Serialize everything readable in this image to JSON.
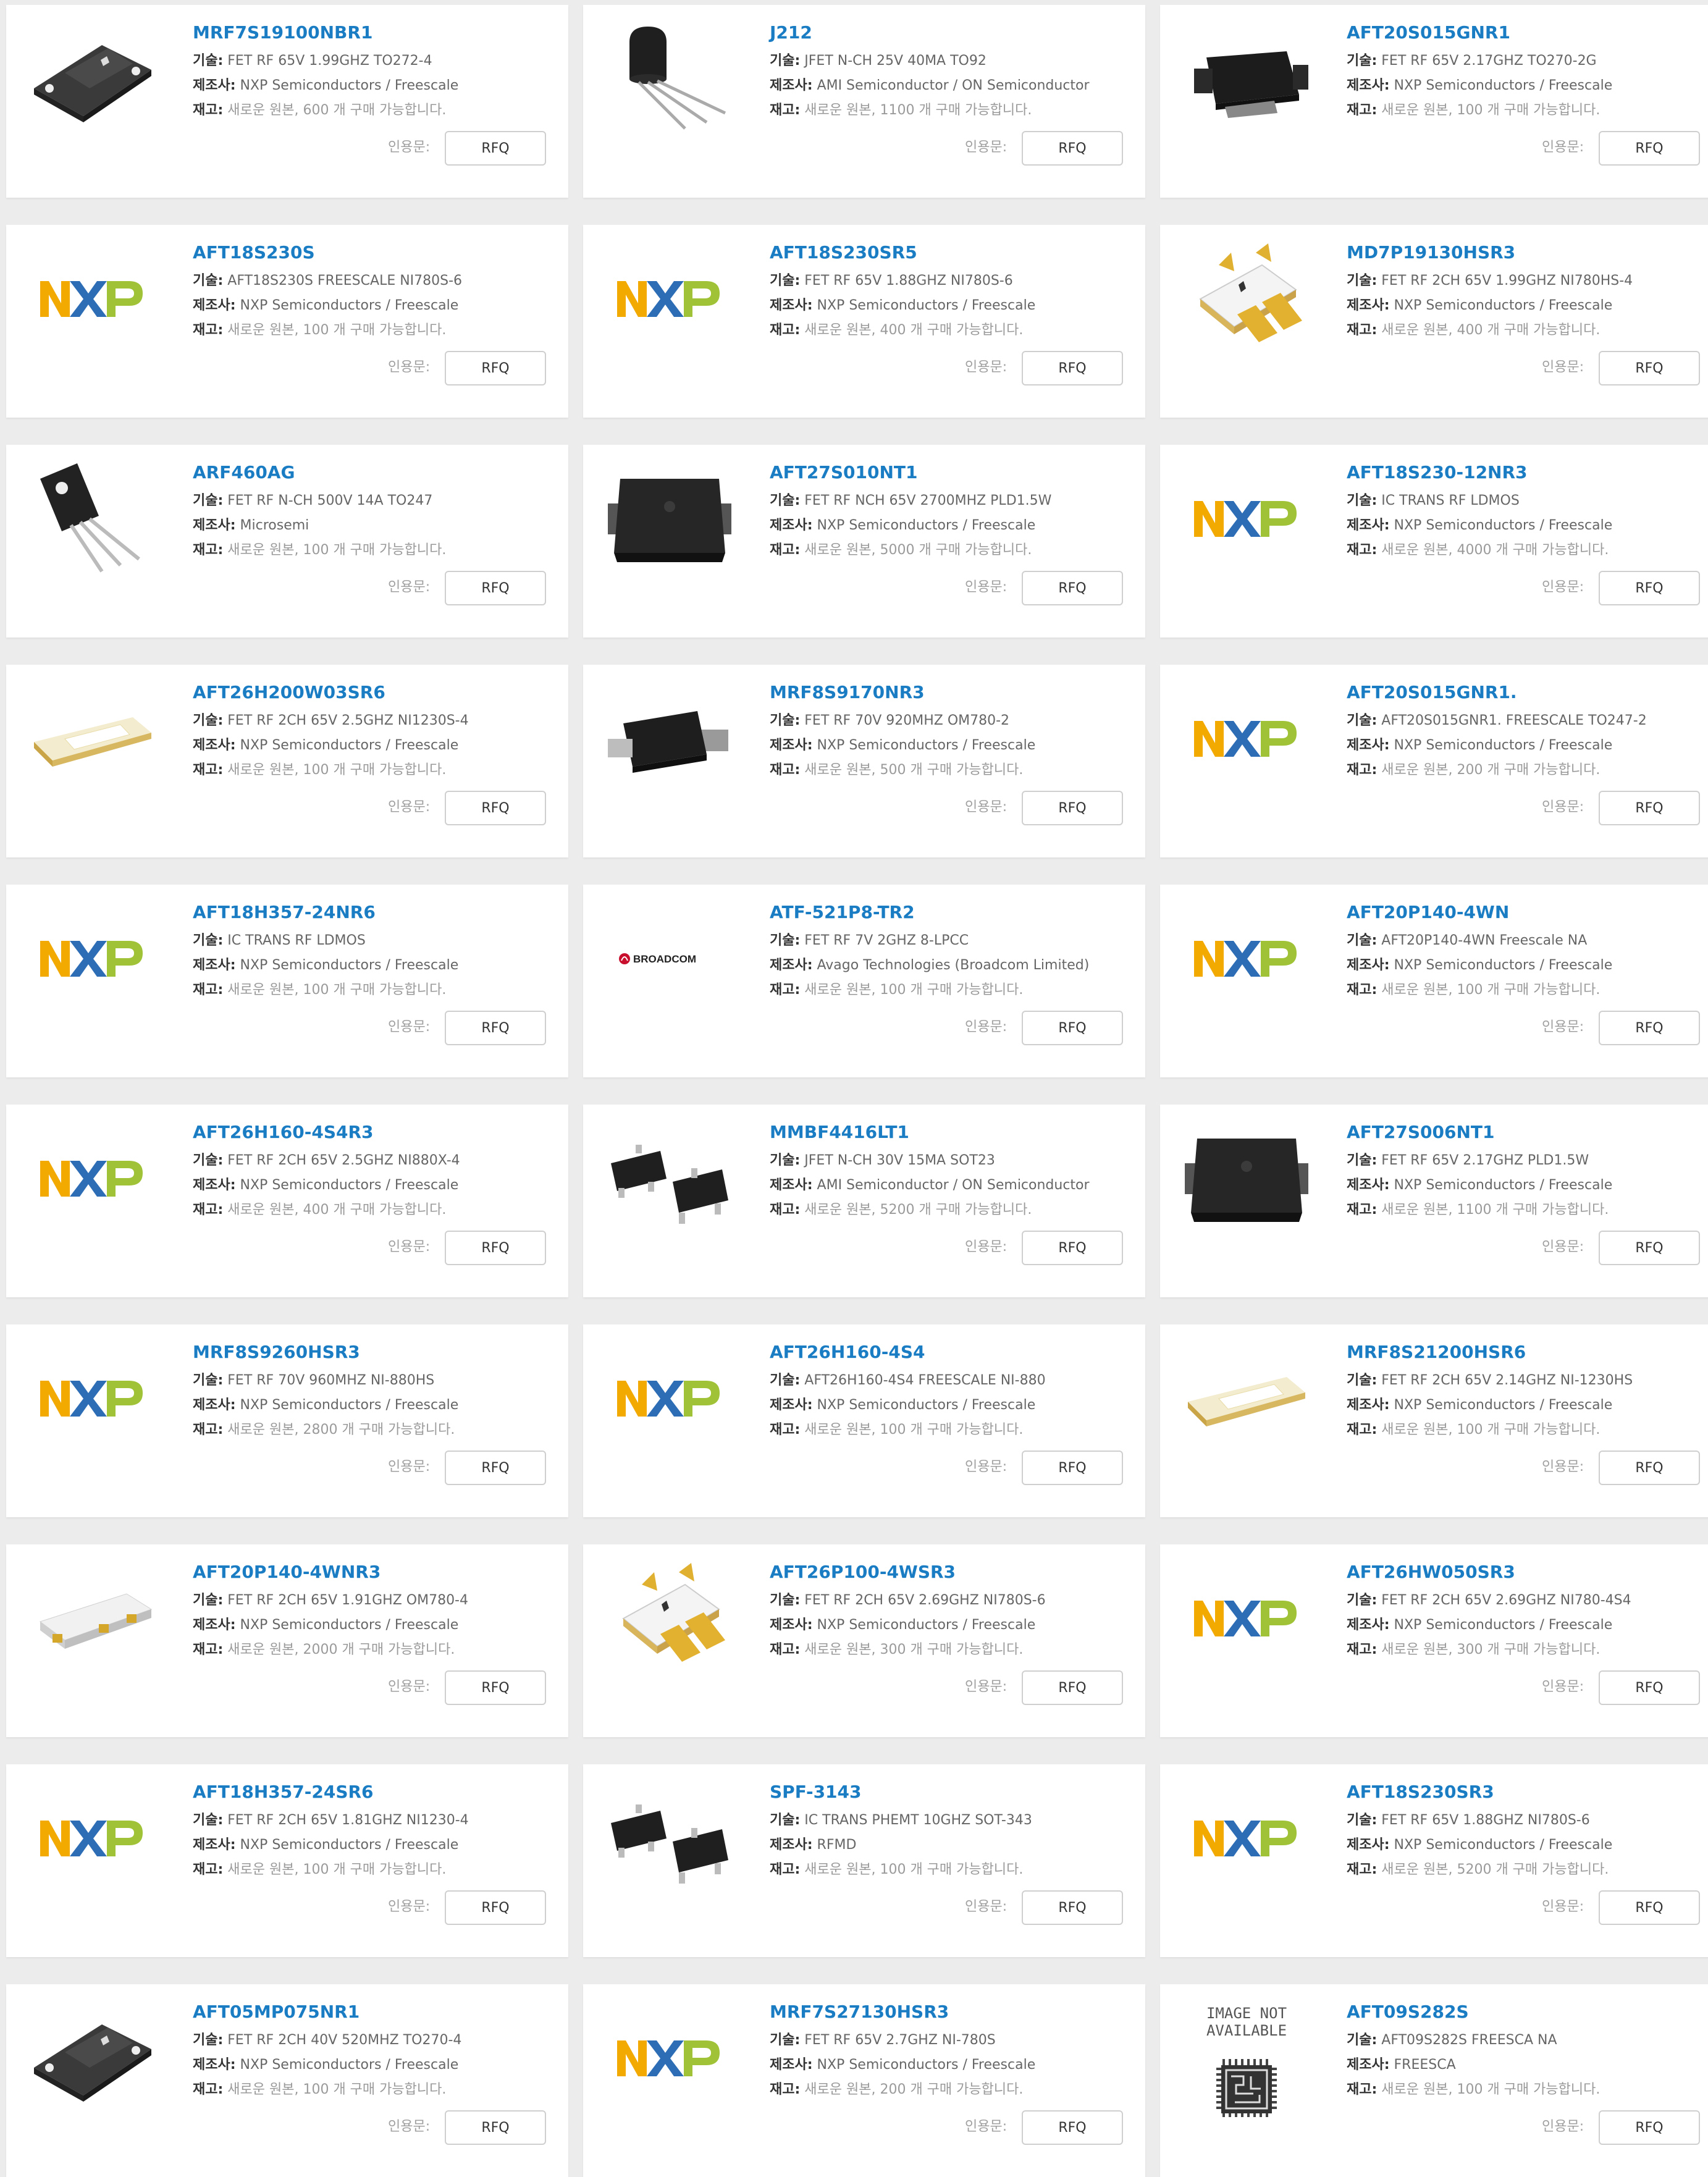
{
  "labels": {
    "desc": "기술:",
    "mfr": "제조사:",
    "stock": "재고:",
    "quote": "인용문:",
    "rfq_button": "RFQ"
  },
  "colors": {
    "part_link": "#1a7dc4",
    "nxp_n": "#f2a900",
    "nxp_x": "#2d6db5",
    "nxp_p": "#9fc236"
  },
  "products": [
    {
      "part": "MRF7S19100NBR1",
      "desc": "FET RF 65V 1.99GHZ TO272-4",
      "mfr": "NXP Semiconductors / Freescale",
      "stock": "새로운 원본, 600 개 구매 가능합니다.",
      "image": "flange-black-package"
    },
    {
      "part": "J212",
      "desc": "JFET N-CH 25V 40MA TO92",
      "mfr": "AMI Semiconductor / ON Semiconductor",
      "stock": "새로운 원본, 1100 개 구매 가능합니다.",
      "image": "to92-package"
    },
    {
      "part": "AFT20S015GNR1",
      "desc": "FET RF 65V 2.17GHZ TO270-2G",
      "mfr": "NXP Semiconductors / Freescale",
      "stock": "새로운 원본, 100 개 구매 가능합니다.",
      "image": "to270-package"
    },
    {
      "part": "AFT18S230S",
      "desc": "AFT18S230S FREESCALE NI780S-6",
      "mfr": "NXP Semiconductors / Freescale",
      "stock": "새로운 원본, 100 개 구매 가능합니다.",
      "image": "nxp-logo"
    },
    {
      "part": "AFT18S230SR5",
      "desc": "FET RF 65V 1.88GHZ NI780S-6",
      "mfr": "NXP Semiconductors / Freescale",
      "stock": "새로운 원본, 400 개 구매 가능합니다.",
      "image": "nxp-logo"
    },
    {
      "part": "MD7P19130HSR3",
      "desc": "FET RF 2CH 65V 1.99GHZ NI780HS-4",
      "mfr": "NXP Semiconductors / Freescale",
      "stock": "새로운 원본, 400 개 구매 가능합니다.",
      "image": "gold-lead-package"
    },
    {
      "part": "ARF460AG",
      "desc": "FET RF N-CH 500V 14A TO247",
      "mfr": "Microsemi",
      "stock": "새로운 원본, 100 개 구매 가능합니다.",
      "image": "to247-package"
    },
    {
      "part": "AFT27S010NT1",
      "desc": "FET RF NCH 65V 2700MHZ PLD1.5W",
      "mfr": "NXP Semiconductors / Freescale",
      "stock": "새로운 원본, 5000 개 구매 가능합니다.",
      "image": "pld-package"
    },
    {
      "part": "AFT18S230-12NR3",
      "desc": "IC TRANS RF LDMOS",
      "mfr": "NXP Semiconductors / Freescale",
      "stock": "새로운 원본, 4000 개 구매 가능합니다.",
      "image": "nxp-logo"
    },
    {
      "part": "AFT26H200W03SR6",
      "desc": "FET RF 2CH 65V 2.5GHZ NI1230S-4",
      "mfr": "NXP Semiconductors / Freescale",
      "stock": "새로운 원본, 100 개 구매 가능합니다.",
      "image": "gold-ceramic-package"
    },
    {
      "part": "MRF8S9170NR3",
      "desc": "FET RF 70V 920MHZ OM780-2",
      "mfr": "NXP Semiconductors / Freescale",
      "stock": "새로운 원본, 500 개 구매 가능합니다.",
      "image": "om780-package"
    },
    {
      "part": "AFT20S015GNR1.",
      "desc": "AFT20S015GNR1. FREESCALE TO247-2",
      "mfr": "NXP Semiconductors / Freescale",
      "stock": "새로운 원본, 200 개 구매 가능합니다.",
      "image": "nxp-logo"
    },
    {
      "part": "AFT18H357-24NR6",
      "desc": "IC TRANS RF LDMOS",
      "mfr": "NXP Semiconductors / Freescale",
      "stock": "새로운 원본, 100 개 구매 가능합니다.",
      "image": "nxp-logo"
    },
    {
      "part": "ATF-521P8-TR2",
      "desc": "FET RF 7V 2GHZ 8-LPCC",
      "mfr": "Avago Technologies (Broadcom Limited)",
      "stock": "새로운 원본, 100 개 구매 가능합니다.",
      "image": "broadcom-logo",
      "logo_text": "BROADCOM"
    },
    {
      "part": "AFT20P140-4WN",
      "desc": "AFT20P140-4WN Freescale NA",
      "mfr": "NXP Semiconductors / Freescale",
      "stock": "새로운 원본, 100 개 구매 가능합니다.",
      "image": "nxp-logo"
    },
    {
      "part": "AFT26H160-4S4R3",
      "desc": "FET RF 2CH 65V 2.5GHZ NI880X-4",
      "mfr": "NXP Semiconductors / Freescale",
      "stock": "새로운 원본, 400 개 구매 가능합니다.",
      "image": "nxp-logo"
    },
    {
      "part": "MMBF4416LT1",
      "desc": "JFET N-CH 30V 15MA SOT23",
      "mfr": "AMI Semiconductor / ON Semiconductor",
      "stock": "새로운 원본, 5200 개 구매 가능합니다.",
      "image": "sot23-package"
    },
    {
      "part": "AFT27S006NT1",
      "desc": "FET RF 65V 2.17GHZ PLD1.5W",
      "mfr": "NXP Semiconductors / Freescale",
      "stock": "새로운 원본, 1100 개 구매 가능합니다.",
      "image": "pld-package"
    },
    {
      "part": "MRF8S9260HSR3",
      "desc": "FET RF 70V 960MHZ NI-880HS",
      "mfr": "NXP Semiconductors / Freescale",
      "stock": "새로운 원본, 2800 개 구매 가능합니다.",
      "image": "nxp-logo"
    },
    {
      "part": "AFT26H160-4S4",
      "desc": "AFT26H160-4S4 FREESCALE NI-880",
      "mfr": "NXP Semiconductors / Freescale",
      "stock": "새로운 원본, 100 개 구매 가능합니다.",
      "image": "nxp-logo"
    },
    {
      "part": "MRF8S21200HSR6",
      "desc": "FET RF 2CH 65V 2.14GHZ NI-1230HS",
      "mfr": "NXP Semiconductors / Freescale",
      "stock": "새로운 원본, 100 개 구매 가능합니다.",
      "image": "gold-ceramic-package"
    },
    {
      "part": "AFT20P140-4WNR3",
      "desc": "FET RF 2CH 65V 1.91GHZ OM780-4",
      "mfr": "NXP Semiconductors / Freescale",
      "stock": "새로운 원본, 2000 개 구매 가능합니다.",
      "image": "white-ceramic-package"
    },
    {
      "part": "AFT26P100-4WSR3",
      "desc": "FET RF 2CH 65V 2.69GHZ NI780S-6",
      "mfr": "NXP Semiconductors / Freescale",
      "stock": "새로운 원본, 300 개 구매 가능합니다.",
      "image": "gold-lead-package"
    },
    {
      "part": "AFT26HW050SR3",
      "desc": "FET RF 2CH 65V 2.69GHZ NI780-4S4",
      "mfr": "NXP Semiconductors / Freescale",
      "stock": "새로운 원본, 300 개 구매 가능합니다.",
      "image": "nxp-logo"
    },
    {
      "part": "AFT18H357-24SR6",
      "desc": "FET RF 2CH 65V 1.81GHZ NI1230-4",
      "mfr": "NXP Semiconductors / Freescale",
      "stock": "새로운 원본, 100 개 구매 가능합니다.",
      "image": "nxp-logo"
    },
    {
      "part": "SPF-3143",
      "desc": "IC TRANS PHEMT 10GHZ SOT-343",
      "mfr": "RFMD",
      "stock": "새로운 원본, 100 개 구매 가능합니다.",
      "image": "sot23-package"
    },
    {
      "part": "AFT18S230SR3",
      "desc": "FET RF 65V 1.88GHZ NI780S-6",
      "mfr": "NXP Semiconductors / Freescale",
      "stock": "새로운 원본, 5200 개 구매 가능합니다.",
      "image": "nxp-logo"
    },
    {
      "part": "AFT05MP075NR1",
      "desc": "FET RF 2CH 40V 520MHZ TO270-4",
      "mfr": "NXP Semiconductors / Freescale",
      "stock": "새로운 원본, 100 개 구매 가능합니다.",
      "image": "flange-black-package"
    },
    {
      "part": "MRF7S27130HSR3",
      "desc": "FET RF 65V 2.7GHZ NI-780S",
      "mfr": "NXP Semiconductors / Freescale",
      "stock": "새로운 원본, 200 개 구매 가능합니다.",
      "image": "nxp-logo"
    },
    {
      "part": "AFT09S282S",
      "desc": "AFT09S282S FREESCA NA",
      "mfr": "FREESCA",
      "stock": "새로운 원본, 100 개 구매 가능합니다.",
      "image": "image-not-available",
      "logo_text": "IMAGE NOT AVAILABLE"
    }
  ]
}
